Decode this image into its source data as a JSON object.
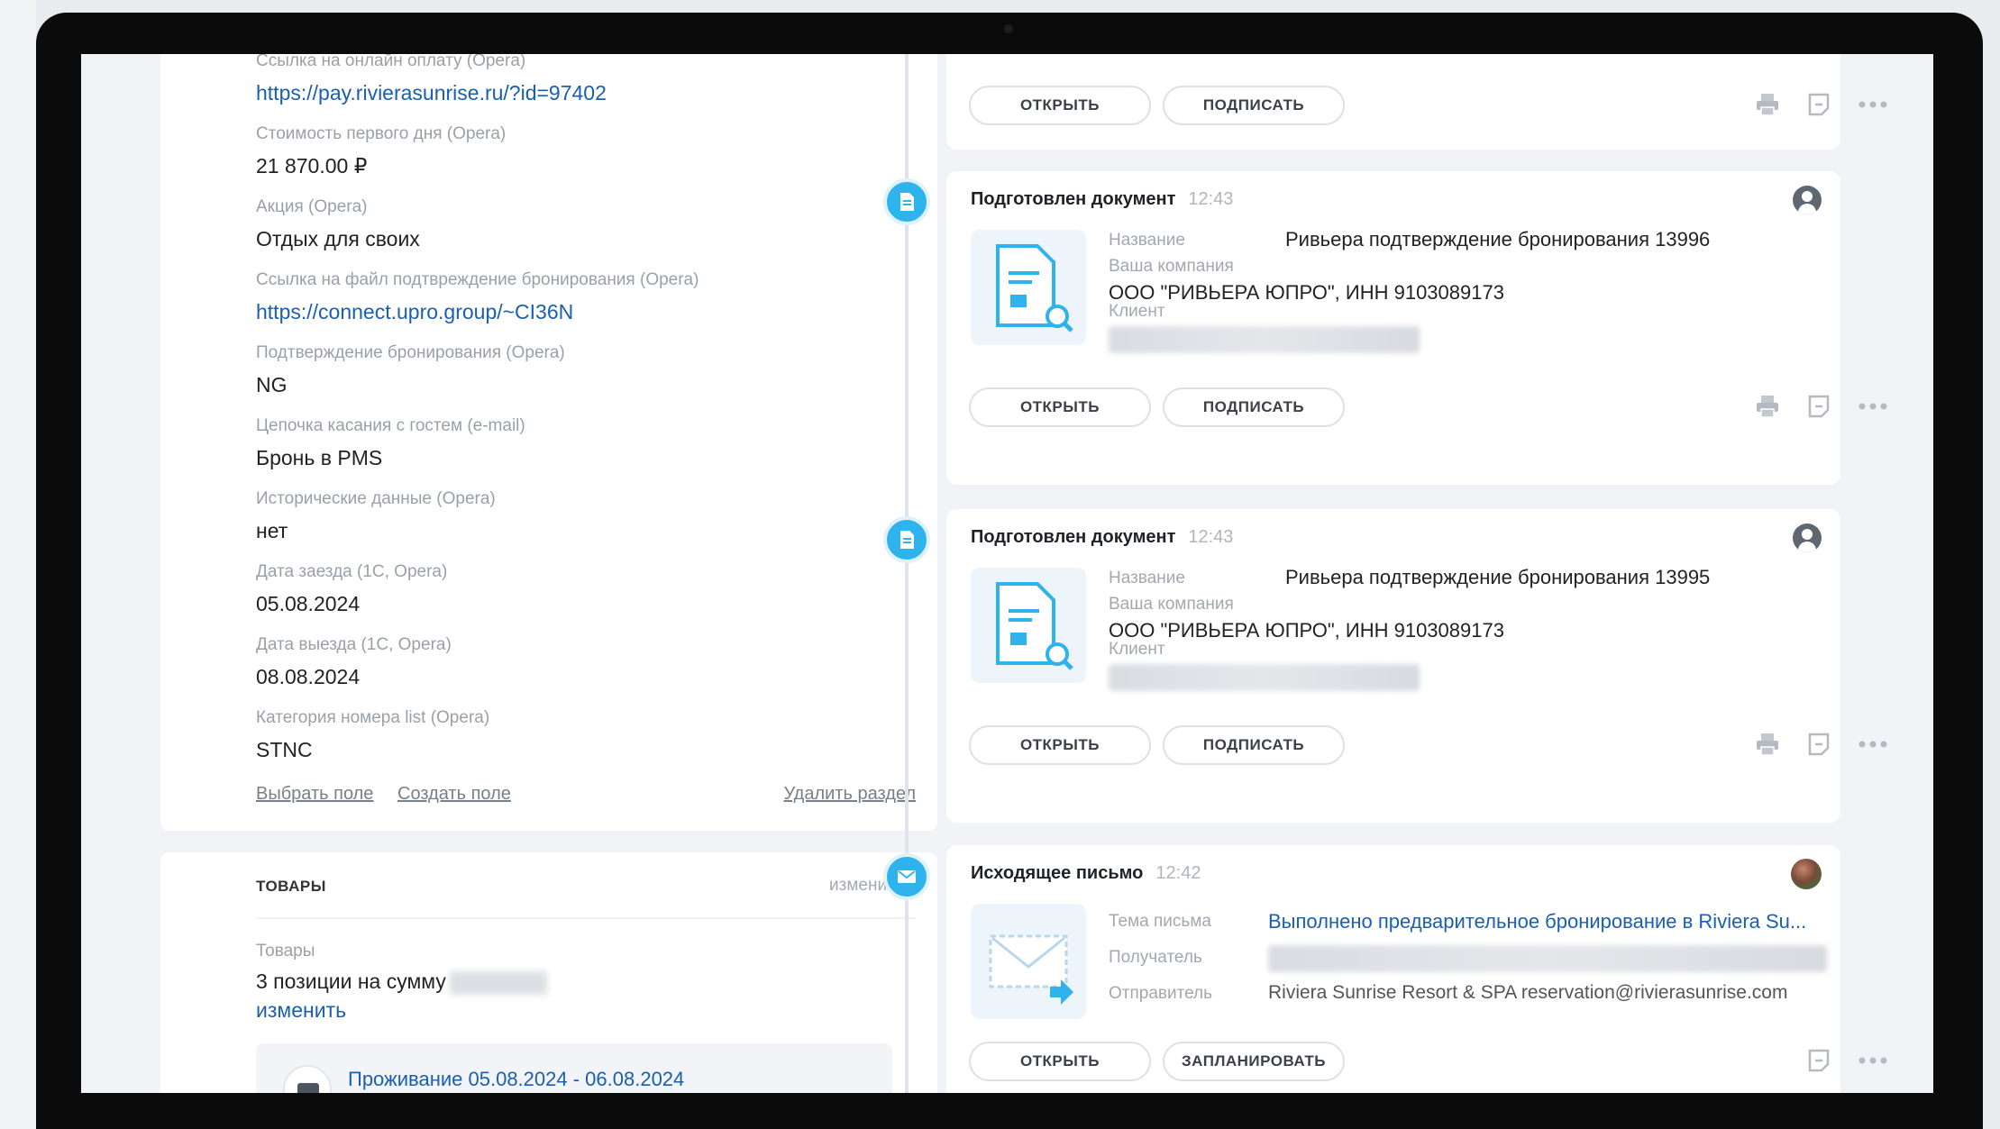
{
  "fields": [
    {
      "label": "Ссылка на онлайн оплату (Opera)",
      "value": "https://pay.rivierasunrise.ru/?id=97402",
      "link": true
    },
    {
      "label": "Стоимость первого дня (Opera)",
      "value": "21 870.00 ₽",
      "link": false
    },
    {
      "label": "Акция (Opera)",
      "value": "Отдых для своих",
      "link": false
    },
    {
      "label": "Ссылка на файл подтвреждение бронирования (Opera)",
      "value": "https://connect.upro.group/~CI36N",
      "link": true
    },
    {
      "label": "Подтверждение бронирования (Opera)",
      "value": "NG",
      "link": false
    },
    {
      "label": "Цепочка касания с гостем (e-mail)",
      "value": "Бронь в PMS",
      "link": false
    },
    {
      "label": "Исторические данные (Opera)",
      "value": "нет",
      "link": false
    },
    {
      "label": "Дата заезда (1С, Opera)",
      "value": "05.08.2024",
      "link": false
    },
    {
      "label": "Дата выезда (1С, Opera)",
      "value": "08.08.2024",
      "link": false
    },
    {
      "label": "Категория номера list (Opera)",
      "value": "STNC",
      "link": false
    }
  ],
  "field_actions": {
    "select_field": "Выбрать поле",
    "create_field": "Создать поле",
    "delete_section": "Удалить раздел"
  },
  "goods": {
    "title": "ТОВАРЫ",
    "edit": "изменить",
    "label": "Товары",
    "summary": "3 позиции на сумму",
    "edit_link": "изменить",
    "product": "Проживание 05.08.2024 - 06.08.2024"
  },
  "top_card": {
    "open": "ОТКРЫТЬ",
    "sign": "ПОДПИСАТЬ"
  },
  "events": [
    {
      "title": "Подготовлен документ",
      "time": "12:43",
      "name_label": "Название",
      "name_value": "Ривьера подтверждение бронирования 13996",
      "company_label": "Ваша компания",
      "company_value": "ООО \"РИВЬЕРА ЮПРО\", ИНН 9103089173",
      "client_label": "Клиент",
      "open": "ОТКРЫТЬ",
      "sign": "ПОДПИСАТЬ"
    },
    {
      "title": "Подготовлен документ",
      "time": "12:43",
      "name_label": "Название",
      "name_value": "Ривьера подтверждение бронирования 13995",
      "company_label": "Ваша компания",
      "company_value": "ООО \"РИВЬЕРА ЮПРО\", ИНН 9103089173",
      "client_label": "Клиент",
      "open": "ОТКРЫТЬ",
      "sign": "ПОДПИСАТЬ"
    }
  ],
  "email_event": {
    "title": "Исходящее письмо",
    "time": "12:42",
    "subject_label": "Тема письма",
    "subject_value": "Выполнено предварительное бронирование в Riviera Su...",
    "recipient_label": "Получатель",
    "sender_label": "Отправитель",
    "sender_value": "Riviera Sunrise Resort & SPA reservation@rivierasunrise.com",
    "open": "ОТКРЫТЬ",
    "schedule": "ЗАПЛАНИРОВАТЬ"
  },
  "icons": {
    "print": "printer-icon",
    "note": "note-icon",
    "more": "more-icon",
    "doc": "document-icon",
    "mail": "mail-icon",
    "user": "user-avatar-icon"
  },
  "colors": {
    "accent": "#2eb3ec",
    "link": "#1a5fb0"
  }
}
